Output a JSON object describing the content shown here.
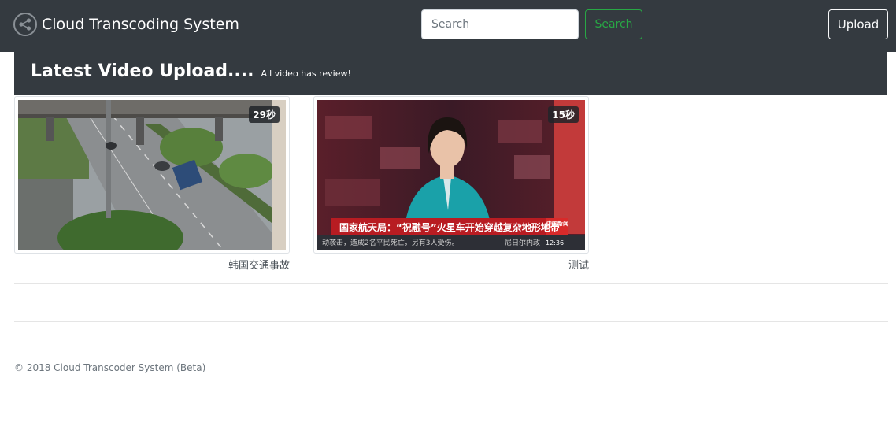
{
  "navbar": {
    "brand_title": "Cloud Transcoding System",
    "brand_icon": "share-nodes-icon",
    "search_placeholder": "Search",
    "search_button": "Search",
    "upload_button": "Upload"
  },
  "section": {
    "title": "Latest Video Upload....",
    "subtitle": "All video has review!"
  },
  "videos": [
    {
      "duration": "29秒",
      "caption": "韩国交通事故"
    },
    {
      "duration": "15秒",
      "caption": "测试",
      "thumbnail_text": {
        "headline": "国家航天局：“祝融号”火星车开始穿越复杂地形地带",
        "ticker": "动袭击，造成2名平民死亡，另有3人受伤。",
        "ticker_right": "尼日尔内政",
        "logo": "中国新闻",
        "time": "12:36"
      }
    }
  ],
  "footer": {
    "text": "© 2018 Cloud Transcoder System (Beta)"
  },
  "colors": {
    "navbar_bg": "#343a40",
    "search_btn": "#28a745"
  }
}
